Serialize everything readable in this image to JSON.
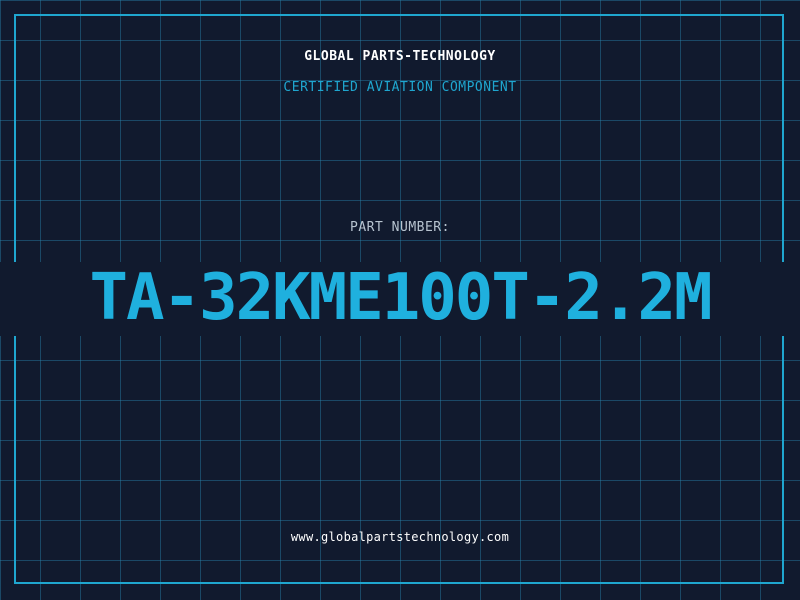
{
  "header": {
    "company": "GLOBAL PARTS-TECHNOLOGY",
    "subtitle": "CERTIFIED AVIATION COMPONENT"
  },
  "part": {
    "label": "PART NUMBER:",
    "number": "TA-32KME100T-2.2M"
  },
  "footer": {
    "website": "www.globalpartstechnology.com"
  },
  "colors": {
    "background": "#111a2e",
    "grid": "#1f6f8f",
    "accent": "#1fa6cf",
    "part_number": "#1fb0de",
    "white": "#ffffff",
    "label": "#b8c4d0"
  }
}
